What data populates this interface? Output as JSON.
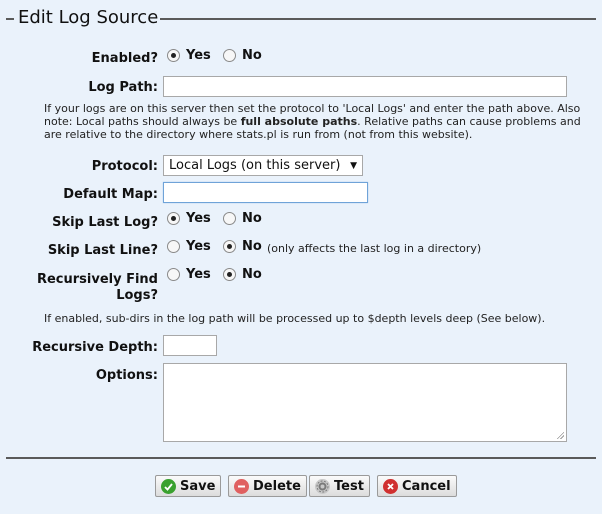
{
  "legend": "Edit Log Source",
  "fields": {
    "enabled": {
      "label": "Enabled?",
      "options": [
        "Yes",
        "No"
      ],
      "selected": "Yes"
    },
    "log_path": {
      "label": "Log Path:",
      "value": ""
    },
    "log_path_help_part1": "If your logs are on this server then set the protocol to 'Local Logs' and enter the path above. Also note: Local paths should always be ",
    "log_path_help_bold": "full absolute paths",
    "log_path_help_part2": ". Relative paths can cause problems and are relative to the directory where stats.pl is run from (not from this website).",
    "protocol": {
      "label": "Protocol:",
      "value": "Local Logs (on this server)"
    },
    "default_map": {
      "label": "Default Map:",
      "value": ""
    },
    "skip_last_log": {
      "label": "Skip Last Log?",
      "options": [
        "Yes",
        "No"
      ],
      "selected": "Yes"
    },
    "skip_last_line": {
      "label": "Skip Last Line?",
      "options": [
        "Yes",
        "No"
      ],
      "selected": "No",
      "note": "(only affects the last log in a directory)"
    },
    "recursive_find": {
      "label_line1": "Recursively Find",
      "label_line2": "Logs?",
      "options": [
        "Yes",
        "No"
      ],
      "selected": "No"
    },
    "recursive_help": "If enabled, sub-dirs in the log path will be processed up to $depth levels deep (See below).",
    "recursive_depth": {
      "label": "Recursive Depth:",
      "value": ""
    },
    "options_field": {
      "label": "Options:",
      "value": ""
    }
  },
  "buttons": {
    "save": "Save",
    "delete": "Delete",
    "test": "Test",
    "cancel": "Cancel"
  },
  "colors": {
    "save_icon": "#3aa12f",
    "delete_icon": "#e06060",
    "cancel_icon": "#d03030",
    "test_icon": "#9a9a9a"
  }
}
